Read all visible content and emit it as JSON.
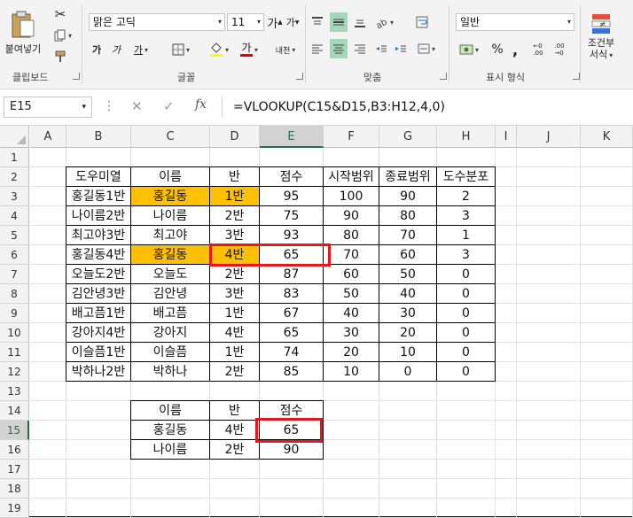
{
  "ribbon": {
    "clipboard": {
      "paste_label": "붙여넣기",
      "group_label": "클립보드"
    },
    "font": {
      "name": "맑은 고딕",
      "size": "11",
      "grow": "가",
      "shrink": "가",
      "bold": "가",
      "italic": "가",
      "underline": "가",
      "font_color_glyph": "가",
      "phonetic": "내천",
      "group_label": "글꼴"
    },
    "alignment": {
      "group_label": "맞춤"
    },
    "number": {
      "format": "일반",
      "percent": "%",
      "comma": ",",
      "group_label": "표시 형식"
    },
    "styles": {
      "conditional_label_1": "조건부",
      "conditional_label_2": "서식"
    }
  },
  "formula_bar": {
    "name_box": "E15",
    "cancel": "✕",
    "enter": "✓",
    "fx": "fx",
    "formula": "=VLOOKUP(C15&D15,B3:H12,4,0)"
  },
  "grid": {
    "columns": [
      "A",
      "B",
      "C",
      "D",
      "E",
      "F",
      "G",
      "H",
      "I",
      "J",
      "K"
    ],
    "rows": [
      "1",
      "2",
      "3",
      "4",
      "5",
      "6",
      "7",
      "8",
      "9",
      "10",
      "11",
      "12",
      "13",
      "14",
      "15",
      "16",
      "17",
      "18",
      "19"
    ],
    "selected_cell": "E15",
    "main_table": {
      "headers": [
        "도우미열",
        "이름",
        "반",
        "점수",
        "시작범위",
        "종료범위",
        "도수분포"
      ],
      "rows": [
        [
          "홍길동1반",
          "홍길동",
          "1반",
          "95",
          "100",
          "90",
          "2"
        ],
        [
          "나이름2반",
          "나이름",
          "2반",
          "75",
          "90",
          "80",
          "3"
        ],
        [
          "최고야3반",
          "최고야",
          "3반",
          "93",
          "80",
          "70",
          "1"
        ],
        [
          "홍길동4반",
          "홍길동",
          "4반",
          "65",
          "70",
          "60",
          "3"
        ],
        [
          "오늘도2반",
          "오늘도",
          "2반",
          "87",
          "60",
          "50",
          "0"
        ],
        [
          "김안녕3반",
          "김안녕",
          "3반",
          "83",
          "50",
          "40",
          "0"
        ],
        [
          "배고픔1반",
          "배고픔",
          "1반",
          "67",
          "40",
          "30",
          "0"
        ],
        [
          "강아지4반",
          "강아지",
          "4반",
          "65",
          "30",
          "20",
          "0"
        ],
        [
          "이슬픔1반",
          "이슬픔",
          "1반",
          "74",
          "20",
          "10",
          "0"
        ],
        [
          "박하나2반",
          "박하나",
          "2반",
          "85",
          "10",
          "0",
          "0"
        ]
      ]
    },
    "lookup_table": {
      "headers": [
        "이름",
        "반",
        "점수"
      ],
      "rows": [
        [
          "홍길동",
          "4반",
          "65"
        ],
        [
          "나이름",
          "2반",
          "90"
        ]
      ]
    },
    "highlight_color": "#ffc000",
    "annotation_color": "#e0191d"
  }
}
